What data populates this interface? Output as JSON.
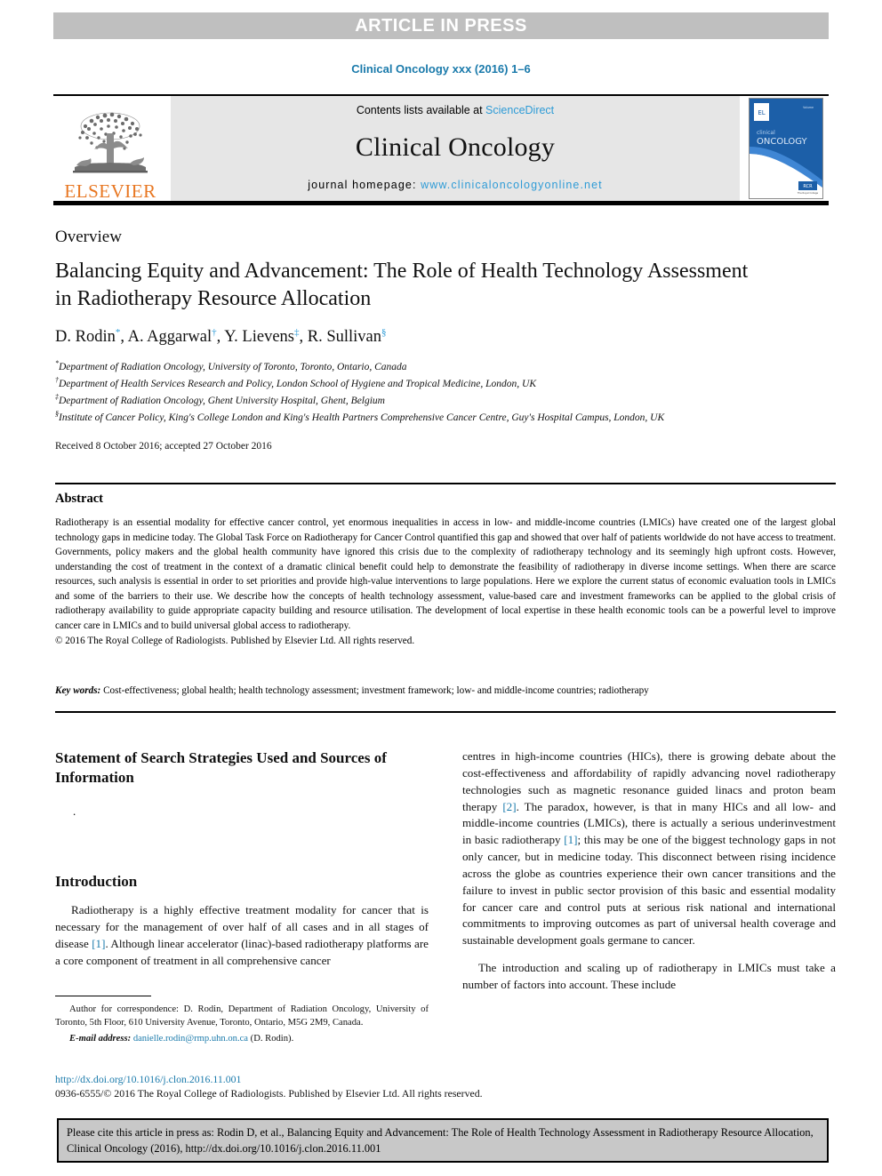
{
  "banner": {
    "label": "ARTICLE IN PRESS"
  },
  "running_head": "Clinical Oncology xxx (2016) 1–6",
  "masthead": {
    "publisher": "ELSEVIER",
    "contents_prefix": "Contents lists available at ",
    "contents_link": "ScienceDirect",
    "journal_title": "Clinical Oncology",
    "homepage_prefix": "journal homepage: ",
    "homepage_url": "www.clinicaloncologyonline.net",
    "cover_line1": "clinical",
    "cover_line2": "ONCOLOGY"
  },
  "article": {
    "type": "Overview",
    "title": "Balancing Equity and Advancement: The Role of Health Technology Assessment in Radiotherapy Resource Allocation",
    "authors_plain": "D. Rodin *, A. Aggarwal †, Y. Lievens ‡, R. Sullivan §",
    "author_list": [
      {
        "name": "D. Rodin",
        "marker": "*"
      },
      {
        "name": "A. Aggarwal",
        "marker": "†"
      },
      {
        "name": "Y. Lievens",
        "marker": "‡"
      },
      {
        "name": "R. Sullivan",
        "marker": "§"
      }
    ],
    "affiliations": [
      {
        "marker": "*",
        "text": "Department of Radiation Oncology, University of Toronto, Toronto, Ontario, Canada"
      },
      {
        "marker": "†",
        "text": "Department of Health Services Research and Policy, London School of Hygiene and Tropical Medicine, London, UK"
      },
      {
        "marker": "‡",
        "text": "Department of Radiation Oncology, Ghent University Hospital, Ghent, Belgium"
      },
      {
        "marker": "§",
        "text": "Institute of Cancer Policy, King's College London and King's Health Partners Comprehensive Cancer Centre, Guy's Hospital Campus, London, UK"
      }
    ],
    "received": "Received 8 October 2016; accepted 27 October 2016"
  },
  "abstract": {
    "heading": "Abstract",
    "body": "Radiotherapy is an essential modality for effective cancer control, yet enormous inequalities in access in low- and middle-income countries (LMICs) have created one of the largest global technology gaps in medicine today. The Global Task Force on Radiotherapy for Cancer Control quantified this gap and showed that over half of patients worldwide do not have access to treatment. Governments, policy makers and the global health community have ignored this crisis due to the complexity of radiotherapy technology and its seemingly high upfront costs. However, understanding the cost of treatment in the context of a dramatic clinical benefit could help to demonstrate the feasibility of radiotherapy in diverse income settings. When there are scarce resources, such analysis is essential in order to set priorities and provide high-value interventions to large populations. Here we explore the current status of economic evaluation tools in LMICs and some of the barriers to their use. We describe how the concepts of health technology assessment, value-based care and investment frameworks can be applied to the global crisis of radiotherapy availability to guide appropriate capacity building and resource utilisation. The development of local expertise in these health economic tools can be a powerful level to improve cancer care in LMICs and to build universal global access to radiotherapy.",
    "copyright": "© 2016 The Royal College of Radiologists. Published by Elsevier Ltd. All rights reserved.",
    "keywords_label": "Key words:",
    "keywords_value": "Cost-effectiveness; global health; health technology assessment; investment framework; low- and middle-income countries; radiotherapy"
  },
  "body": {
    "left": {
      "search_heading": "Statement of Search Strategies Used and Sources of Information",
      "search_body": ".",
      "intro_heading": "Introduction",
      "intro_part1": "Radiotherapy is a highly effective treatment modality for cancer that is necessary for the management of over half of all cases and in all stages of disease ",
      "intro_ref1": "[1]",
      "intro_part2": ". Although linear accelerator (linac)-based radiotherapy platforms are a core component of treatment in all comprehensive cancer"
    },
    "right": {
      "p1_a": "centres in high-income countries (HICs), there is growing debate about the cost-effectiveness and affordability of rapidly advancing novel radiotherapy technologies such as magnetic resonance guided linacs and proton beam therapy ",
      "p1_ref1": "[2]",
      "p1_b": ". The paradox, however, is that in many HICs and all low- and middle-income countries (LMICs), there is actually a serious underinvestment in basic radiotherapy ",
      "p1_ref2": "[1]",
      "p1_c": "; this may be one of the biggest technology gaps in not only cancer, but in medicine today. This disconnect between rising incidence across the globe as countries experience their own cancer transitions and the failure to invest in public sector provision of this basic and essential modality for cancer care and control puts at serious risk national and international commitments to improving outcomes as part of universal health coverage and sustainable development goals germane to cancer.",
      "p2": "The introduction and scaling up of radiotherapy in LMICs must take a number of factors into account. These include"
    }
  },
  "footnote": {
    "correspondence": "Author for correspondence: D. Rodin, Department of Radiation Oncology, University of Toronto, 5th Floor, 610 University Avenue, Toronto, Ontario, M5G 2M9, Canada.",
    "email_label": "E-mail address:",
    "email": "danielle.rodin@rmp.uhn.on.ca",
    "email_suffix": " (D. Rodin)."
  },
  "footer": {
    "doi": "http://dx.doi.org/10.1016/j.clon.2016.11.001",
    "issn_line": "0936-6555/© 2016 The Royal College of Radiologists. Published by Elsevier Ltd. All rights reserved."
  },
  "citation_box": {
    "text": "Please cite this article in press as: Rodin D, et al., Balancing Equity and Advancement: The Role of Health Technology Assessment in Radiotherapy Resource Allocation, Clinical Oncology (2016), http://dx.doi.org/10.1016/j.clon.2016.11.001"
  },
  "colors": {
    "link_blue": "#2e9bd6",
    "heading_blue": "#1a7aab",
    "elsevier_orange": "#e87722",
    "banner_gray": "#bfbfbf",
    "band_gray": "#e6e6e6",
    "cite_gray": "#c8c8c8",
    "cover_blue": "#1c5fa8"
  }
}
